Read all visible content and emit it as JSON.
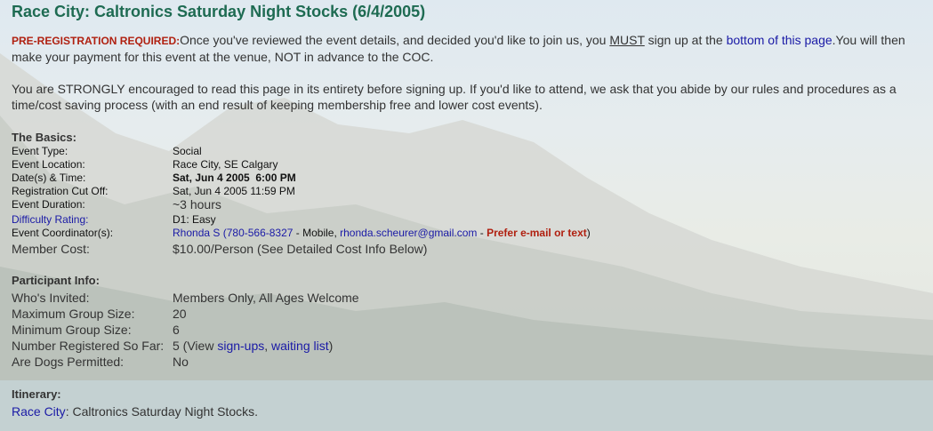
{
  "title": "Race City: Caltronics Saturday Night Stocks (6/4/2005)",
  "intro": {
    "prereg_label": "PRE-REGISTRATION REQUIRED:",
    "text1": "Once you've reviewed the event details, and decided you'd like to join us, you ",
    "must": "MUST",
    "text2": " sign up at the ",
    "bottom_link": "bottom of this page",
    "text3": ".You will then make your payment for this event at the venue, NOT in advance to the COC."
  },
  "encourage": "You are STRONGLY encouraged to read this page in its entirety before signing up. If you'd like to attend, we ask that you abide by our rules and procedures as a time/cost saving process (with an end result of keeping membership free and lower cost events).",
  "basics": {
    "heading": "The Basics:",
    "event_type": {
      "label": "Event Type:",
      "value": "Social"
    },
    "event_location": {
      "label": "Event Location:",
      "value": "Race City, SE Calgary"
    },
    "date_time": {
      "label": "Date(s) & Time:",
      "value": "Sat, Jun 4 2005  6:00 PM"
    },
    "cutoff": {
      "label": "Registration Cut Off:",
      "value": "Sat, Jun 4 2005 11:59 PM"
    },
    "duration": {
      "label": "Event Duration:",
      "value": "~3 hours"
    },
    "difficulty": {
      "label": "Difficulty Rating:",
      "value": "D1: Easy"
    },
    "coordinator": {
      "label": "Event Coordinator(s):",
      "name": "Rhonda S",
      "phone": "(780-566-8327",
      "mobile": " - Mobile, ",
      "email": "rhonda.scheurer@gmail.com",
      "dash": " - ",
      "prefer": "Prefer e-mail or text",
      "close": ")"
    },
    "member_cost": {
      "label": "Member Cost:",
      "value": "$10.00/Person (See Detailed Cost Info Below)"
    }
  },
  "participant": {
    "heading": "Participant Info:",
    "invited": {
      "label": "Who's Invited:",
      "value": "Members Only, All Ages Welcome"
    },
    "max_group": {
      "label": "Maximum Group Size:",
      "value": "20"
    },
    "min_group": {
      "label": "Minimum Group Size:",
      "value": "6"
    },
    "registered": {
      "label": "Number Registered So Far:",
      "count_prefix": "5 (View ",
      "signups_link": "sign-ups",
      "comma": ", ",
      "waiting_link": "waiting list",
      "close": ")"
    },
    "dogs": {
      "label": "Are Dogs Permitted:",
      "value": "No"
    }
  },
  "itinerary": {
    "heading": "Itinerary:",
    "link": "Race City",
    "text": ": Caltronics Saturday Night Stocks."
  },
  "colors": {
    "title": "#1e6b52",
    "alert": "#b02010",
    "link": "#1a1aa6"
  }
}
